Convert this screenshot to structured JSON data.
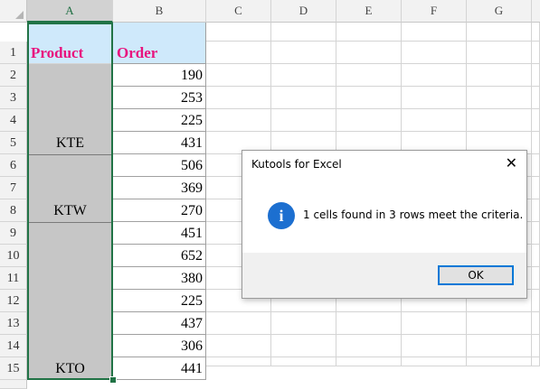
{
  "columns": [
    "A",
    "B",
    "C",
    "D",
    "E",
    "F",
    "G"
  ],
  "rows": [
    "1",
    "2",
    "3",
    "4",
    "5",
    "6",
    "7",
    "8",
    "9",
    "10",
    "11",
    "12",
    "13",
    "14",
    "15"
  ],
  "headers": {
    "product": "Product",
    "order": "Order"
  },
  "orders": [
    "190",
    "253",
    "225",
    "431",
    "506",
    "369",
    "270",
    "451",
    "652",
    "380",
    "225",
    "437",
    "306",
    "441"
  ],
  "merged_labels": [
    "KTE",
    "KTW",
    "KTO"
  ],
  "dialog": {
    "title": "Kutools for Excel",
    "close": "✕",
    "icon": "i",
    "message": "1 cells found in 3 rows meet the criteria.",
    "ok_label": "OK"
  },
  "colors": {
    "header_fill": "#cfe9fb",
    "header_text": "#e8137e",
    "selection": "#217346",
    "merged_fill": "#c6c6c6",
    "info_icon": "#1c6fd0"
  }
}
